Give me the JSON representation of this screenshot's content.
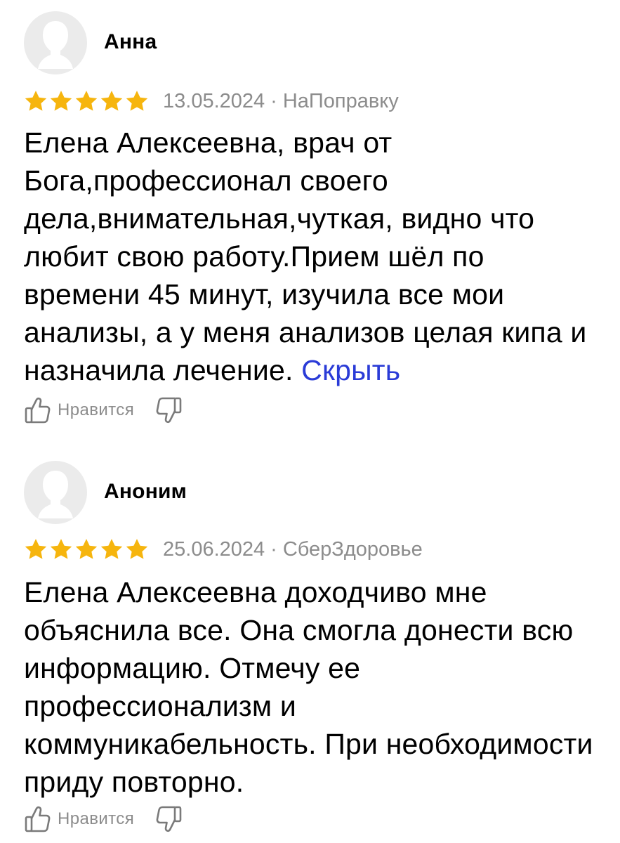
{
  "reviews": [
    {
      "author": "Анна",
      "rating": 5,
      "date": "13.05.2024",
      "separator": "·",
      "source": "НаПоправку",
      "text": "Елена Алексеевна, врач от Бога,профессионал своего дела,внимательная,чуткая, видно что любит свою работу.Прием шёл по времени 45 минут, изучила все мои анализы, а у меня анализов целая кипа и назначила лечение.",
      "hide_label": "Скрыть",
      "like_label": "Нравится",
      "icons": {
        "avatar": "user-placeholder-icon",
        "like": "thumbs-up-icon",
        "dislike": "thumbs-down-icon",
        "star": "star-icon"
      }
    },
    {
      "author": "Аноним",
      "rating": 5,
      "date": "25.06.2024",
      "separator": "·",
      "source": "СберЗдоровье",
      "text": "Елена Алексеевна доходчиво мне объяснила все. Она смогла донести всю информацию. Отмечу ее профессионализм и коммуникабельность. При необходимости приду повторно.",
      "like_label": "Нравится",
      "icons": {
        "avatar": "user-placeholder-icon",
        "like": "thumbs-up-icon",
        "dislike": "thumbs-down-icon",
        "star": "star-icon"
      }
    }
  ],
  "colors": {
    "star": "#f6b50e",
    "meta": "#8c8c8c",
    "link": "#2a3bd7",
    "avatar_bg": "#ebebeb",
    "avatar_fg": "#ffffff"
  }
}
